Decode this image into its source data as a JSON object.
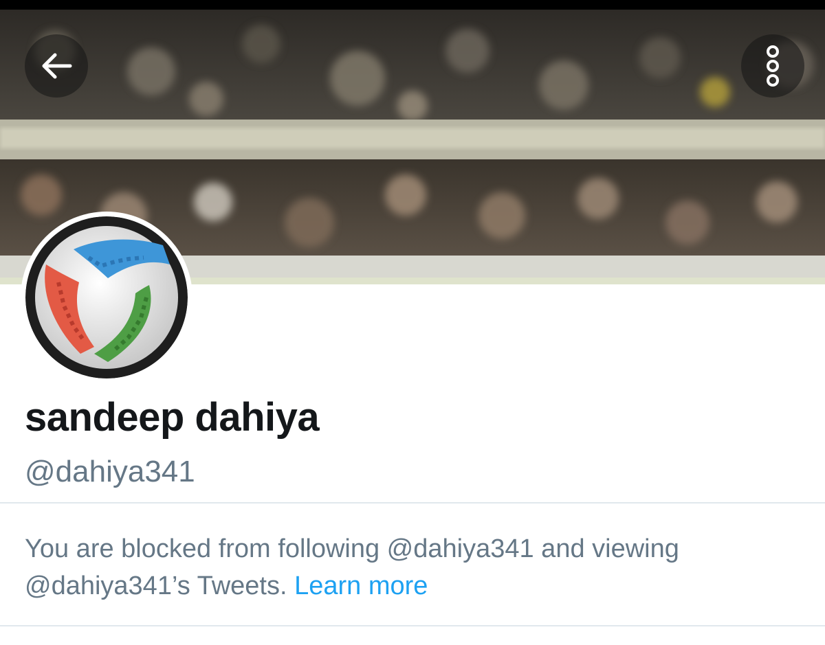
{
  "header": {
    "back_icon": "arrow-left-icon",
    "more_icon": "more-vertical-icon"
  },
  "profile": {
    "display_name": "sandeep dahiya",
    "handle": "@dahiya341",
    "avatar_icon": "soccer-ball-boots-icon"
  },
  "notice": {
    "line1": "You are blocked from following @dahiya341 and viewing",
    "line2": "@dahiya341’s Tweets. ",
    "link": "Learn more"
  },
  "colors": {
    "name": "#14171a",
    "secondary": "#657786",
    "link": "#1da1f2",
    "divider": "#e1e8ed"
  }
}
